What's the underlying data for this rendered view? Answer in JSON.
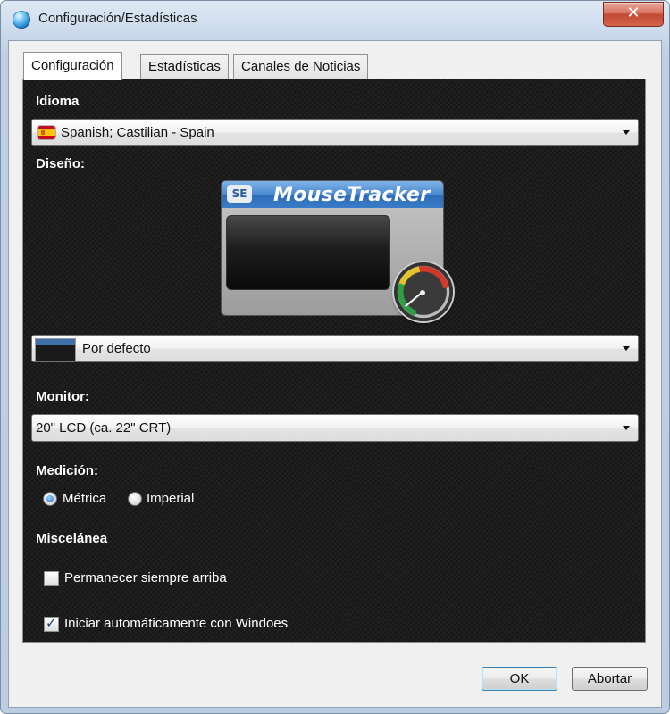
{
  "window": {
    "title": "Configuración/Estadísticas",
    "close_label": "✕"
  },
  "tabs": [
    {
      "label": "Configuración",
      "active": true
    },
    {
      "label": "Estadísticas",
      "active": false
    },
    {
      "label": "Canales de Noticias",
      "active": false
    }
  ],
  "idioma": {
    "label": "Idioma",
    "value": "Spanish; Castilian - Spain",
    "icon": "spain-flag-icon"
  },
  "diseno": {
    "label": "Diseño:",
    "preview_logo": "SE",
    "preview_title": "MouseTracker",
    "value": "Por defecto"
  },
  "monitor": {
    "label": "Monitor:",
    "value": "20\" LCD (ca. 22\" CRT)"
  },
  "medicion": {
    "label": "Medición:",
    "options": [
      {
        "label": "Métrica",
        "selected": true
      },
      {
        "label": "Imperial",
        "selected": false
      }
    ]
  },
  "miscelanea": {
    "label": "Miscelánea",
    "always_on_top": {
      "label": "Permanecer siempre arriba",
      "checked": false
    },
    "autostart": {
      "label": "Iniciar automáticamente con Windoes",
      "checked": true
    }
  },
  "buttons": {
    "ok": "OK",
    "cancel": "Abortar"
  }
}
